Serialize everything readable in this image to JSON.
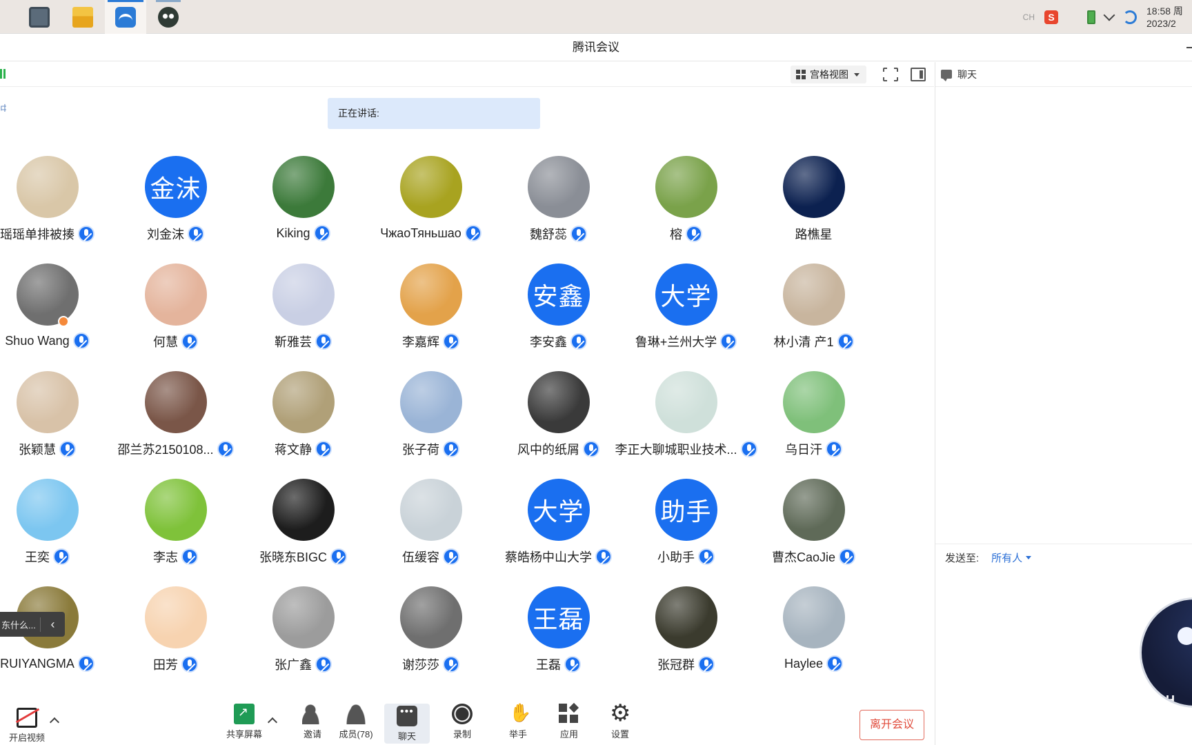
{
  "taskbar": {
    "apps": [
      {
        "name": "calculator"
      },
      {
        "name": "file-explorer"
      },
      {
        "name": "tencent-meeting",
        "active": true
      },
      {
        "name": "owl-app"
      }
    ],
    "tray": {
      "ime": "CH",
      "time": "18:58 周",
      "date": "2023/2"
    }
  },
  "window": {
    "title": "腾讯会议"
  },
  "toolbar": {
    "view_label": "宫格视图"
  },
  "speaking": {
    "label": "正在讲话:"
  },
  "chat": {
    "title": "聊天",
    "send_to_label": "发送至:",
    "send_to_value": "所有人"
  },
  "drawer": {
    "text": "东什么..."
  },
  "participants": [
    {
      "name": "瑶瑶单排被揍",
      "avatar": "mask-photo",
      "color": "#d9c7a8"
    },
    {
      "name": "刘金沫",
      "avatar_text": "金沫"
    },
    {
      "name": "Kiking",
      "avatar": "egrets-photo",
      "color": "#3c7a3a"
    },
    {
      "name": "ЧжаоТяньшао",
      "avatar": "airport-sign-photo",
      "color": "#a8a320"
    },
    {
      "name": "魏舒蕊",
      "avatar": "portrait-photo",
      "color": "#8a8e96"
    },
    {
      "name": "榕",
      "avatar": "flowers-photo",
      "color": "#7aa24a"
    },
    {
      "name": "路樵星",
      "avatar": "stage-photo",
      "color": "#0c2150"
    },
    {
      "name": "Shuo Wang",
      "avatar": "man-photo",
      "color": "#6f6f6f",
      "host": true
    },
    {
      "name": "何慧",
      "avatar": "painting-photo",
      "color": "#e4b49c"
    },
    {
      "name": "靳雅芸",
      "avatar": "bear-photo",
      "color": "#c9cfe4"
    },
    {
      "name": "李嘉辉",
      "avatar": "illustration-photo",
      "color": "#e3a24a"
    },
    {
      "name": "李安鑫",
      "avatar_text": "安鑫"
    },
    {
      "name": "鲁琳+兰州大学",
      "avatar_text": "大学"
    },
    {
      "name": "林小清 产1",
      "avatar": "child-photo",
      "color": "#c8b59e"
    },
    {
      "name": "张颖慧",
      "avatar": "bunny-photo",
      "color": "#d8c2a8"
    },
    {
      "name": "邵兰苏2150108...",
      "avatar": "woman-photo",
      "color": "#7a5648"
    },
    {
      "name": "蒋文静",
      "avatar": "cartoon-photo",
      "color": "#b0a078"
    },
    {
      "name": "张子荷",
      "avatar": "hand-photo",
      "color": "#9ab4d6"
    },
    {
      "name": "风中的纸屑",
      "avatar": "dark-portrait-photo",
      "color": "#3a3a3a"
    },
    {
      "name": "李正大聊城职业技术...",
      "avatar": "jade-photo",
      "color": "#cfe0da"
    },
    {
      "name": "乌日汗",
      "avatar": "green-shirt-photo",
      "color": "#7fc07a"
    },
    {
      "name": "王奕",
      "avatar": "sky-flower-photo",
      "color": "#7cc6f0"
    },
    {
      "name": "李志",
      "avatar": "clover-photo",
      "color": "#7fc23a"
    },
    {
      "name": "张晓东BIGC",
      "avatar": "dark-hair-photo",
      "color": "#1d1d1d"
    },
    {
      "name": "伍缓容",
      "avatar": "raccoon-photo",
      "color": "#c9d2d8"
    },
    {
      "name": "蔡皓杨中山大学",
      "avatar_text": "大学"
    },
    {
      "name": "小助手",
      "avatar_text": "助手"
    },
    {
      "name": "曹杰CaoJie",
      "avatar": "street-photo",
      "color": "#5f6a58"
    },
    {
      "name": "RUIYANGMA",
      "avatar": "tree-photo",
      "color": "#8a7a3a"
    },
    {
      "name": "田芳",
      "avatar": "puppy-cartoon",
      "color": "#f7d3b0"
    },
    {
      "name": "张广鑫",
      "avatar": "horses-photo",
      "color": "#9c9c9c"
    },
    {
      "name": "谢莎莎",
      "avatar": "hands-photo",
      "color": "#6f6f6f"
    },
    {
      "name": "王磊",
      "avatar_text": "王磊"
    },
    {
      "name": "张冠群",
      "avatar": "selfie-photo",
      "color": "#3b3b2e"
    },
    {
      "name": "Haylee",
      "avatar": "girl-photo",
      "color": "#a7b4bf"
    }
  ],
  "controls": [
    {
      "label": "开启视频",
      "icon": "video-off-icon"
    },
    {
      "label": "共享屏幕",
      "icon": "share-screen-icon"
    },
    {
      "label": "邀请",
      "icon": "invite-icon"
    },
    {
      "label": "成员(78)",
      "icon": "members-icon"
    },
    {
      "label": "聊天",
      "icon": "chat-icon",
      "active": true
    },
    {
      "label": "录制",
      "icon": "record-icon"
    },
    {
      "label": "举手",
      "icon": "raise-hand-icon"
    },
    {
      "label": "应用",
      "icon": "apps-icon"
    },
    {
      "label": "设置",
      "icon": "settings-icon"
    }
  ],
  "leave": {
    "label": "离开会议"
  },
  "floating_avatar": {
    "badge": "CH"
  }
}
